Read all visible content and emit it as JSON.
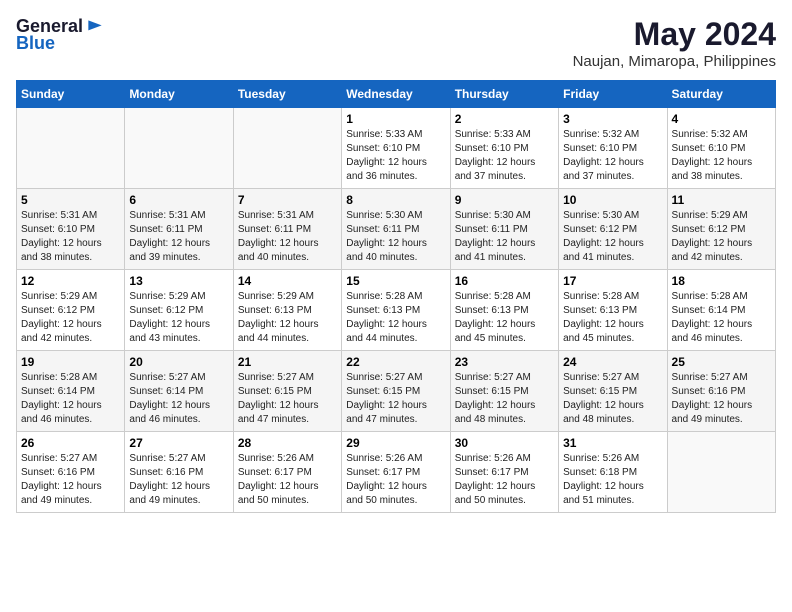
{
  "logo": {
    "line1": "General",
    "line2": "Blue"
  },
  "title": "May 2024",
  "subtitle": "Naujan, Mimaropa, Philippines",
  "days_of_week": [
    "Sunday",
    "Monday",
    "Tuesday",
    "Wednesday",
    "Thursday",
    "Friday",
    "Saturday"
  ],
  "weeks": [
    [
      {
        "day": "",
        "info": ""
      },
      {
        "day": "",
        "info": ""
      },
      {
        "day": "",
        "info": ""
      },
      {
        "day": "1",
        "info": "Sunrise: 5:33 AM\nSunset: 6:10 PM\nDaylight: 12 hours\nand 36 minutes."
      },
      {
        "day": "2",
        "info": "Sunrise: 5:33 AM\nSunset: 6:10 PM\nDaylight: 12 hours\nand 37 minutes."
      },
      {
        "day": "3",
        "info": "Sunrise: 5:32 AM\nSunset: 6:10 PM\nDaylight: 12 hours\nand 37 minutes."
      },
      {
        "day": "4",
        "info": "Sunrise: 5:32 AM\nSunset: 6:10 PM\nDaylight: 12 hours\nand 38 minutes."
      }
    ],
    [
      {
        "day": "5",
        "info": "Sunrise: 5:31 AM\nSunset: 6:10 PM\nDaylight: 12 hours\nand 38 minutes."
      },
      {
        "day": "6",
        "info": "Sunrise: 5:31 AM\nSunset: 6:11 PM\nDaylight: 12 hours\nand 39 minutes."
      },
      {
        "day": "7",
        "info": "Sunrise: 5:31 AM\nSunset: 6:11 PM\nDaylight: 12 hours\nand 40 minutes."
      },
      {
        "day": "8",
        "info": "Sunrise: 5:30 AM\nSunset: 6:11 PM\nDaylight: 12 hours\nand 40 minutes."
      },
      {
        "day": "9",
        "info": "Sunrise: 5:30 AM\nSunset: 6:11 PM\nDaylight: 12 hours\nand 41 minutes."
      },
      {
        "day": "10",
        "info": "Sunrise: 5:30 AM\nSunset: 6:12 PM\nDaylight: 12 hours\nand 41 minutes."
      },
      {
        "day": "11",
        "info": "Sunrise: 5:29 AM\nSunset: 6:12 PM\nDaylight: 12 hours\nand 42 minutes."
      }
    ],
    [
      {
        "day": "12",
        "info": "Sunrise: 5:29 AM\nSunset: 6:12 PM\nDaylight: 12 hours\nand 42 minutes."
      },
      {
        "day": "13",
        "info": "Sunrise: 5:29 AM\nSunset: 6:12 PM\nDaylight: 12 hours\nand 43 minutes."
      },
      {
        "day": "14",
        "info": "Sunrise: 5:29 AM\nSunset: 6:13 PM\nDaylight: 12 hours\nand 44 minutes."
      },
      {
        "day": "15",
        "info": "Sunrise: 5:28 AM\nSunset: 6:13 PM\nDaylight: 12 hours\nand 44 minutes."
      },
      {
        "day": "16",
        "info": "Sunrise: 5:28 AM\nSunset: 6:13 PM\nDaylight: 12 hours\nand 45 minutes."
      },
      {
        "day": "17",
        "info": "Sunrise: 5:28 AM\nSunset: 6:13 PM\nDaylight: 12 hours\nand 45 minutes."
      },
      {
        "day": "18",
        "info": "Sunrise: 5:28 AM\nSunset: 6:14 PM\nDaylight: 12 hours\nand 46 minutes."
      }
    ],
    [
      {
        "day": "19",
        "info": "Sunrise: 5:28 AM\nSunset: 6:14 PM\nDaylight: 12 hours\nand 46 minutes."
      },
      {
        "day": "20",
        "info": "Sunrise: 5:27 AM\nSunset: 6:14 PM\nDaylight: 12 hours\nand 46 minutes."
      },
      {
        "day": "21",
        "info": "Sunrise: 5:27 AM\nSunset: 6:15 PM\nDaylight: 12 hours\nand 47 minutes."
      },
      {
        "day": "22",
        "info": "Sunrise: 5:27 AM\nSunset: 6:15 PM\nDaylight: 12 hours\nand 47 minutes."
      },
      {
        "day": "23",
        "info": "Sunrise: 5:27 AM\nSunset: 6:15 PM\nDaylight: 12 hours\nand 48 minutes."
      },
      {
        "day": "24",
        "info": "Sunrise: 5:27 AM\nSunset: 6:15 PM\nDaylight: 12 hours\nand 48 minutes."
      },
      {
        "day": "25",
        "info": "Sunrise: 5:27 AM\nSunset: 6:16 PM\nDaylight: 12 hours\nand 49 minutes."
      }
    ],
    [
      {
        "day": "26",
        "info": "Sunrise: 5:27 AM\nSunset: 6:16 PM\nDaylight: 12 hours\nand 49 minutes."
      },
      {
        "day": "27",
        "info": "Sunrise: 5:27 AM\nSunset: 6:16 PM\nDaylight: 12 hours\nand 49 minutes."
      },
      {
        "day": "28",
        "info": "Sunrise: 5:26 AM\nSunset: 6:17 PM\nDaylight: 12 hours\nand 50 minutes."
      },
      {
        "day": "29",
        "info": "Sunrise: 5:26 AM\nSunset: 6:17 PM\nDaylight: 12 hours\nand 50 minutes."
      },
      {
        "day": "30",
        "info": "Sunrise: 5:26 AM\nSunset: 6:17 PM\nDaylight: 12 hours\nand 50 minutes."
      },
      {
        "day": "31",
        "info": "Sunrise: 5:26 AM\nSunset: 6:18 PM\nDaylight: 12 hours\nand 51 minutes."
      },
      {
        "day": "",
        "info": ""
      }
    ]
  ]
}
